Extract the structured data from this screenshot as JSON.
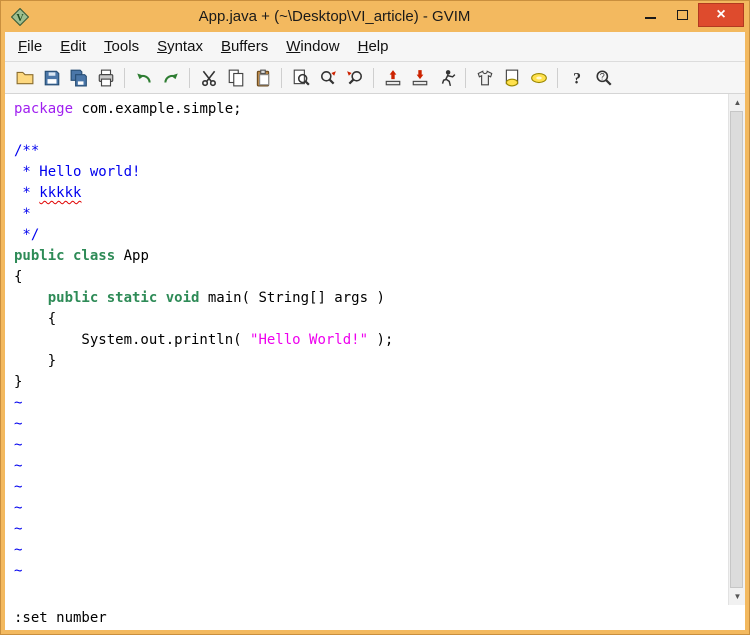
{
  "window": {
    "title": "App.java + (~\\Desktop\\VI_article) - GVIM"
  },
  "titlebar": {
    "close_glyph": "×"
  },
  "menu": {
    "items": [
      {
        "label": "File",
        "accel": "F"
      },
      {
        "label": "Edit",
        "accel": "E"
      },
      {
        "label": "Tools",
        "accel": "T"
      },
      {
        "label": "Syntax",
        "accel": "S"
      },
      {
        "label": "Buffers",
        "accel": "B"
      },
      {
        "label": "Window",
        "accel": "W"
      },
      {
        "label": "Help",
        "accel": "H"
      }
    ]
  },
  "toolbar": {
    "groups": [
      [
        "open",
        "save",
        "save-all",
        "print"
      ],
      [
        "undo",
        "redo"
      ],
      [
        "cut",
        "copy",
        "paste"
      ],
      [
        "find-replace",
        "find-next",
        "find-prev"
      ],
      [
        "load-session",
        "save-session",
        "run-script"
      ],
      [
        "make",
        "run-ctags",
        "tag-jump"
      ],
      [
        "help",
        "find-help"
      ]
    ]
  },
  "editor": {
    "lines": [
      [
        {
          "t": "package",
          "s": "preproc"
        },
        {
          "t": " com.example.simple;",
          "s": "plain"
        }
      ],
      [],
      [
        {
          "t": "/**",
          "s": "comment"
        }
      ],
      [
        {
          "t": " * Hello world!",
          "s": "comment"
        }
      ],
      [
        {
          "t": " * ",
          "s": "comment"
        },
        {
          "t": "kkkkk",
          "s": "spell"
        }
      ],
      [
        {
          "t": " *",
          "s": "comment"
        }
      ],
      [
        {
          "t": " */",
          "s": "comment"
        }
      ],
      [
        {
          "t": "public class",
          "s": "type"
        },
        {
          "t": " App",
          "s": "plain"
        }
      ],
      [
        {
          "t": "{",
          "s": "plain"
        }
      ],
      [
        {
          "t": "    ",
          "s": "plain"
        },
        {
          "t": "public static void",
          "s": "type"
        },
        {
          "t": " main( String[] args )",
          "s": "plain"
        }
      ],
      [
        {
          "t": "    {",
          "s": "plain"
        }
      ],
      [
        {
          "t": "        System.out.println( ",
          "s": "plain"
        },
        {
          "t": "\"Hello World!\"",
          "s": "string"
        },
        {
          "t": " );",
          "s": "plain"
        }
      ],
      [
        {
          "t": "    }",
          "s": "plain"
        }
      ],
      [
        {
          "t": "}",
          "s": "plain"
        }
      ],
      [
        {
          "t": "~",
          "s": "tilde"
        }
      ],
      [
        {
          "t": "~",
          "s": "tilde"
        }
      ],
      [
        {
          "t": "~",
          "s": "tilde"
        }
      ],
      [
        {
          "t": "~",
          "s": "tilde"
        }
      ],
      [
        {
          "t": "~",
          "s": "tilde"
        }
      ],
      [
        {
          "t": "~",
          "s": "tilde"
        }
      ],
      [
        {
          "t": "~",
          "s": "tilde"
        }
      ],
      [
        {
          "t": "~",
          "s": "tilde"
        }
      ],
      [
        {
          "t": "~",
          "s": "tilde"
        }
      ]
    ]
  },
  "statusline": {
    "text": ":set number"
  },
  "colors": {
    "titlebar_bg": "#f3b95f",
    "close_button": "#de4b2d",
    "syntax_preproc": "#a020f0",
    "syntax_comment": "#0000ee",
    "syntax_type": "#2e8b57",
    "syntax_string": "#ee00ee",
    "tilde": "#0000ee",
    "spell_underline": "#e00000"
  }
}
